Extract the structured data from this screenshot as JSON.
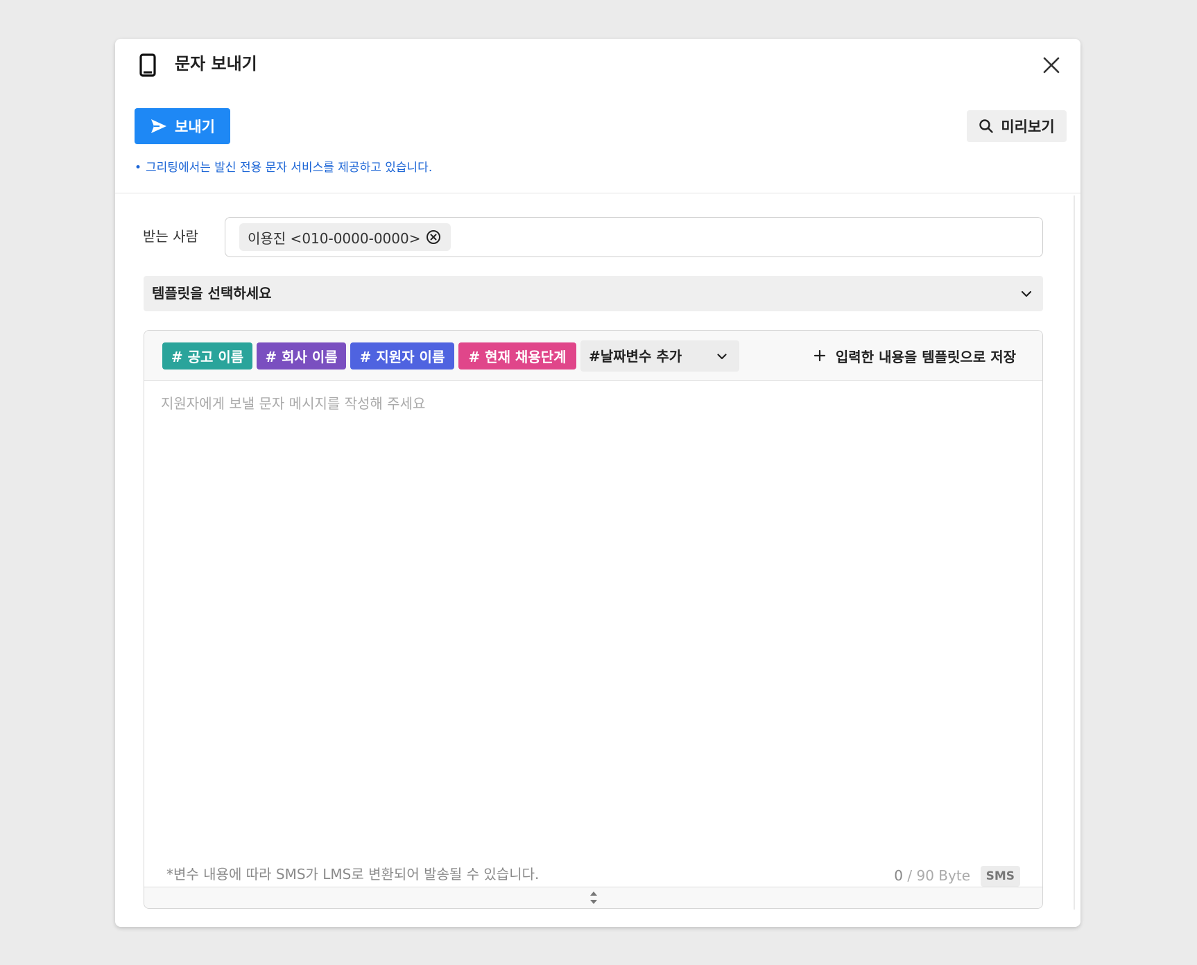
{
  "modal": {
    "title": "문자 보내기",
    "send_label": "보내기",
    "preview_label": "미리보기",
    "notice": "그리팅에서는 발신 전용 문자 서비스를 제공하고 있습니다."
  },
  "recipient": {
    "label": "받는 사람",
    "chips": [
      "이용진 <010-0000-0000>"
    ]
  },
  "template_select": {
    "placeholder": "템플릿을 선택하세요"
  },
  "toolbar": {
    "variables": [
      {
        "label": "# 공고 이름",
        "color": "#2aa49b"
      },
      {
        "label": "# 회사 이름",
        "color": "#7a4fc0"
      },
      {
        "label": "# 지원자 이름",
        "color": "#4f63e0"
      },
      {
        "label": "# 현재 채용단계",
        "color": "#e0468a"
      }
    ],
    "date_variable_label": "#날짜변수 추가",
    "save_template_label": "입력한 내용을 템플릿으로 저장"
  },
  "editor": {
    "value": "",
    "placeholder": "지원자에게 보낼 문자 메시지를 작성해 주세요",
    "footer_note": "*변수 내용에 따라 SMS가 LMS로 변환되어 발송될 수 있습니다.",
    "byte_current": "0",
    "byte_limit": " / 90 Byte",
    "message_type": "SMS"
  },
  "colors": {
    "primary": "#1e88f5",
    "notice": "#1a64d6"
  },
  "icons": [
    "phone-icon",
    "close-icon",
    "send-icon",
    "search-icon",
    "remove-chip-icon",
    "chevron-down-icon",
    "plus-icon",
    "resize-handle-icon"
  ]
}
